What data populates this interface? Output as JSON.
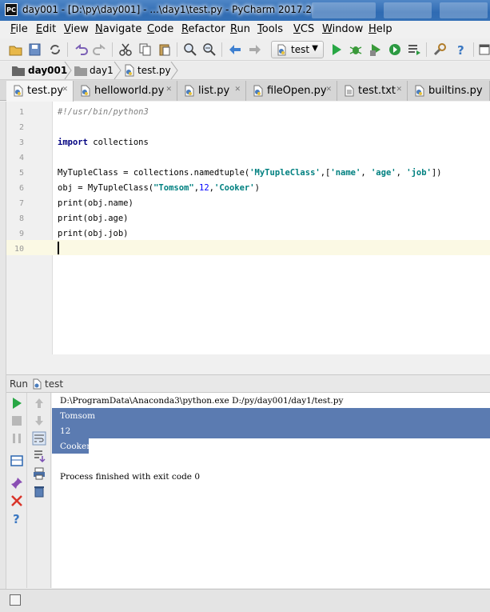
{
  "window": {
    "title": "day001 - [D:\\py\\day001] - ...\\day1\\test.py - PyCharm 2017.2",
    "app_icon": "PC"
  },
  "menu": [
    {
      "label": "File",
      "ul": "F",
      "rest": "ile"
    },
    {
      "label": "Edit",
      "ul": "E",
      "rest": "dit"
    },
    {
      "label": "View",
      "ul": "V",
      "rest": "iew"
    },
    {
      "label": "Navigate",
      "ul": "N",
      "rest": "avigate"
    },
    {
      "label": "Code",
      "ul": "C",
      "rest": "ode"
    },
    {
      "label": "Refactor",
      "ul": "R",
      "rest": "efactor"
    },
    {
      "label": "Run",
      "ul": "R",
      "rest": "un"
    },
    {
      "label": "Tools",
      "ul": "T",
      "rest": "ools"
    },
    {
      "label": "VCS",
      "ul": "V",
      "rest": "CS"
    },
    {
      "label": "Window",
      "ul": "W",
      "rest": "indow"
    },
    {
      "label": "Help",
      "ul": "H",
      "rest": "elp"
    }
  ],
  "toolbar": {
    "run_config": "test"
  },
  "breadcrumb": [
    "day001",
    "day1",
    "test.py"
  ],
  "tabs": [
    "test.py",
    "helloworld.py",
    "list.py",
    "fileOpen.py",
    "test.txt",
    "builtins.py"
  ],
  "editor": {
    "line_numbers": [
      "1",
      "2",
      "3",
      "4",
      "5",
      "6",
      "7",
      "8",
      "9",
      "10"
    ],
    "lines": {
      "l1": "#!/usr/bin/python3",
      "l3_kw": "import",
      "l3_rest": " collections",
      "l5_a": "MyTupleClass = collections.namedtuple(",
      "l5_s1": "'MyTupleClass'",
      "l5_b": ",[",
      "l5_s2": "'name'",
      "l5_c": ", ",
      "l5_s3": "'age'",
      "l5_d": ", ",
      "l5_s4": "'job'",
      "l5_e": "])",
      "l6_a": "obj = MyTupleClass(",
      "l6_s1": "\"Tomsom\"",
      "l6_b": ",",
      "l6_n": "12",
      "l6_c": ",",
      "l6_s2": "'Cooker'",
      "l6_d": ")",
      "l7": "print(obj.name)",
      "l8": "print(obj.age)",
      "l9": "print(obj.job)"
    }
  },
  "run_panel": {
    "label": "Run",
    "config": "test",
    "console": {
      "command": "D:\\ProgramData\\Anaconda3\\python.exe D:/py/day001/day1/test.py",
      "out1": "Tomsom",
      "out2": "12",
      "out3": "Cooker",
      "finish": "Process finished with exit code 0"
    }
  },
  "colors": {
    "keyword": "#000080",
    "string": "#008080",
    "number": "#0000ff",
    "comment": "#808080",
    "selection": "#3e64a3",
    "current_line": "#fbf9e4"
  }
}
